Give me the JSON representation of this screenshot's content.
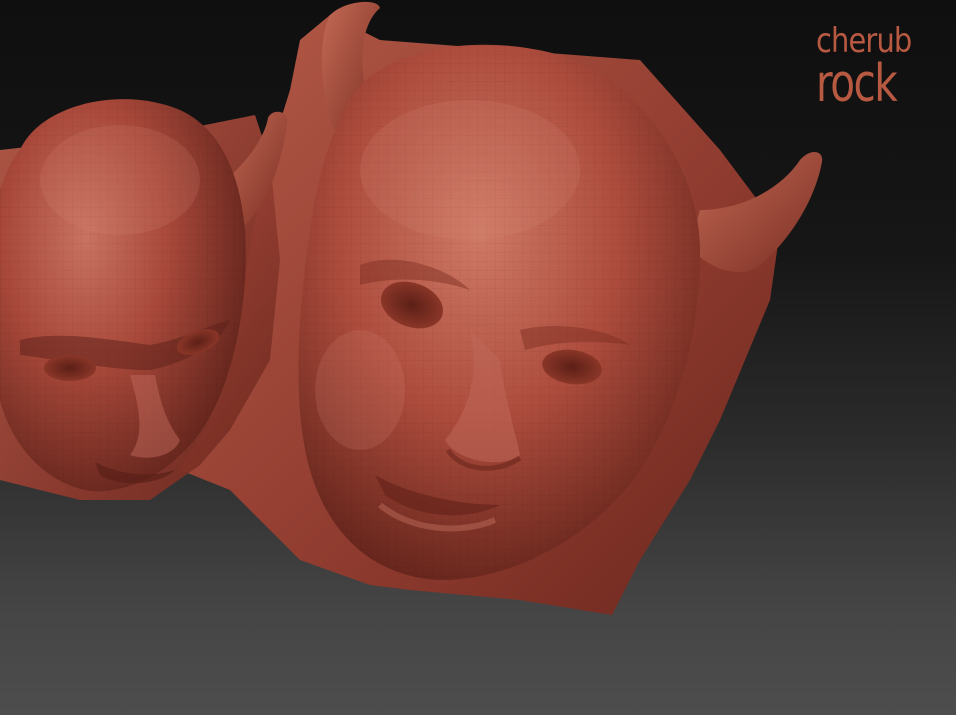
{
  "logo": {
    "line1": "cherub",
    "line2": "rock",
    "color": "#b85a42"
  },
  "palette": {
    "clay_base": "#a8483a",
    "clay_light": "#c26a58",
    "clay_dark": "#5a2018",
    "background_top": "#0f0f0f",
    "background_bottom": "#4d4d4d"
  },
  "scene": {
    "subject": "sculpt-viewport"
  }
}
